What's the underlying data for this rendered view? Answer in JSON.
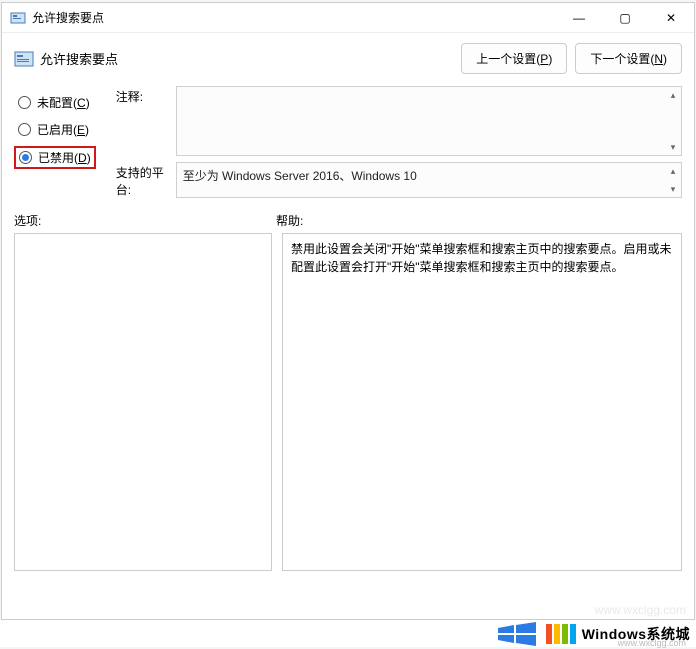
{
  "titlebar": {
    "title": "允许搜索要点"
  },
  "header": {
    "title": "允许搜索要点",
    "prev_btn": "上一个设置",
    "prev_key": "P",
    "next_btn": "下一个设置",
    "next_key": "N"
  },
  "radios": {
    "not_configured": "未配置",
    "not_configured_key": "C",
    "enabled": "已启用",
    "enabled_key": "E",
    "disabled": "已禁用",
    "disabled_key": "D",
    "selected": "disabled"
  },
  "comment_label": "注释:",
  "comment_value": "",
  "platform_label": "支持的平台:",
  "platform_value": "至少为 Windows Server 2016、Windows 10",
  "options_label": "选项:",
  "help_label": "帮助:",
  "help_text": "禁用此设置会关闭\"开始\"菜单搜索框和搜索主页中的搜索要点。启用或未配置此设置会打开\"开始\"菜单搜索框和搜索主页中的搜索要点。",
  "watermark": "www.wxclgg.com",
  "footer": {
    "brand": "Windows系统城",
    "sub": "www.wxclgg.com"
  },
  "colors": {
    "accent": "#2a7be4",
    "highlight_border": "#d11919"
  }
}
